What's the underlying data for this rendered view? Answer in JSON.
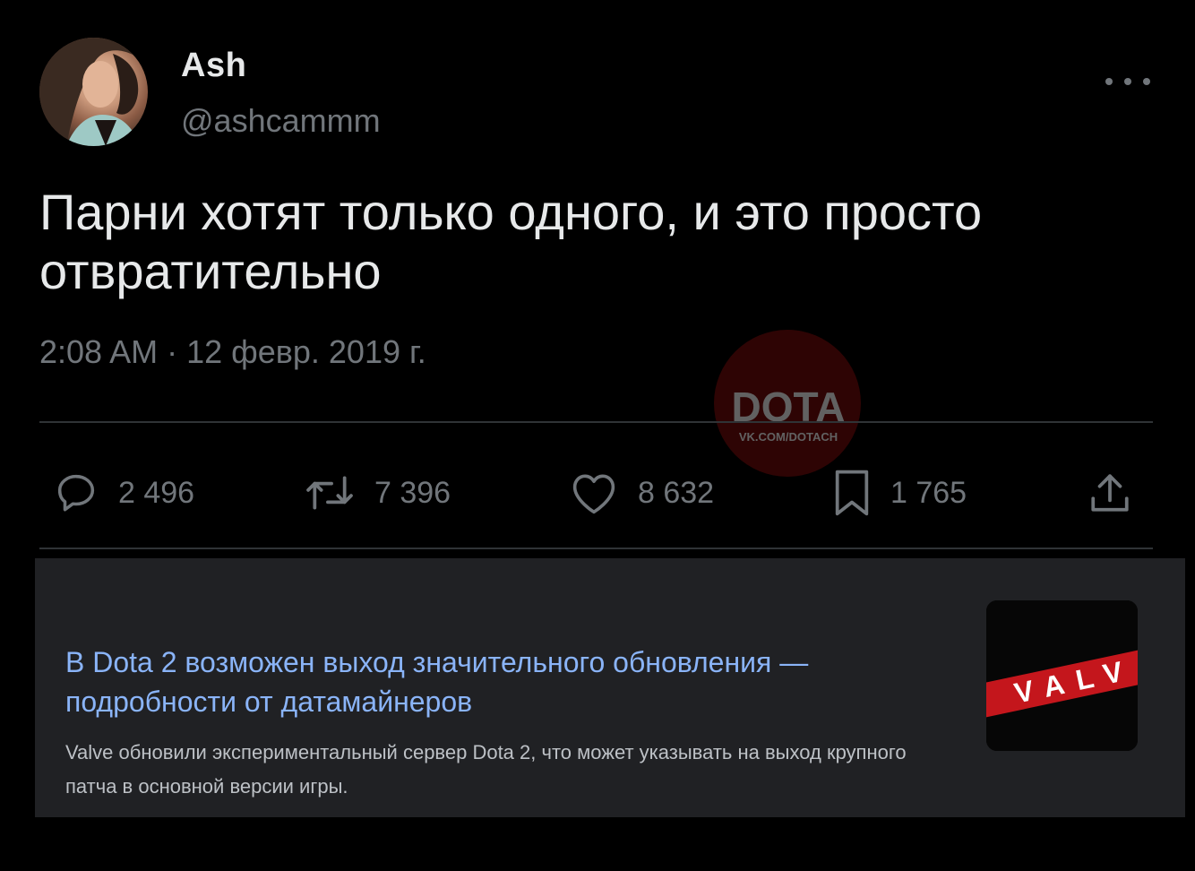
{
  "tweet": {
    "author": {
      "display_name": "Ash",
      "handle": "@ashcammm",
      "avatar_icon": "user-avatar-photo"
    },
    "more_icon": "more-options-icon",
    "text": "Парни хотят только одного, и это просто отвратительно",
    "timestamp": "2:08 AM · 12 февр. 2019 г.",
    "watermark": {
      "logo": "DOTA",
      "sub": "VK.COM/DOTACH"
    },
    "actions": [
      {
        "name": "reply",
        "icon": "reply-icon",
        "count": "2 496"
      },
      {
        "name": "retweet",
        "icon": "retweet-icon",
        "count": "7 396"
      },
      {
        "name": "like",
        "icon": "heart-icon",
        "count": "8 632"
      },
      {
        "name": "bookmark",
        "icon": "bookmark-icon",
        "count": "1 765"
      },
      {
        "name": "share",
        "icon": "share-icon",
        "count": ""
      }
    ],
    "colors": {
      "background": "#000000",
      "primary_text": "#e7e9ea",
      "secondary_text": "#71767b",
      "divider": "#2f3336"
    }
  },
  "news_card": {
    "title": "В Dota 2 возможен выход значительного обновления — подробности от датамайнеров",
    "snippet": "Valve обновили экспериментальный сервер Dota 2, что может указывать на выход крупного патча в основной версии игры.",
    "thumbnail_text": "VALV",
    "colors": {
      "background": "#202124",
      "title": "#8ab4f8",
      "snippet": "#bdc1c6",
      "thumb_red": "#c4161c"
    }
  }
}
